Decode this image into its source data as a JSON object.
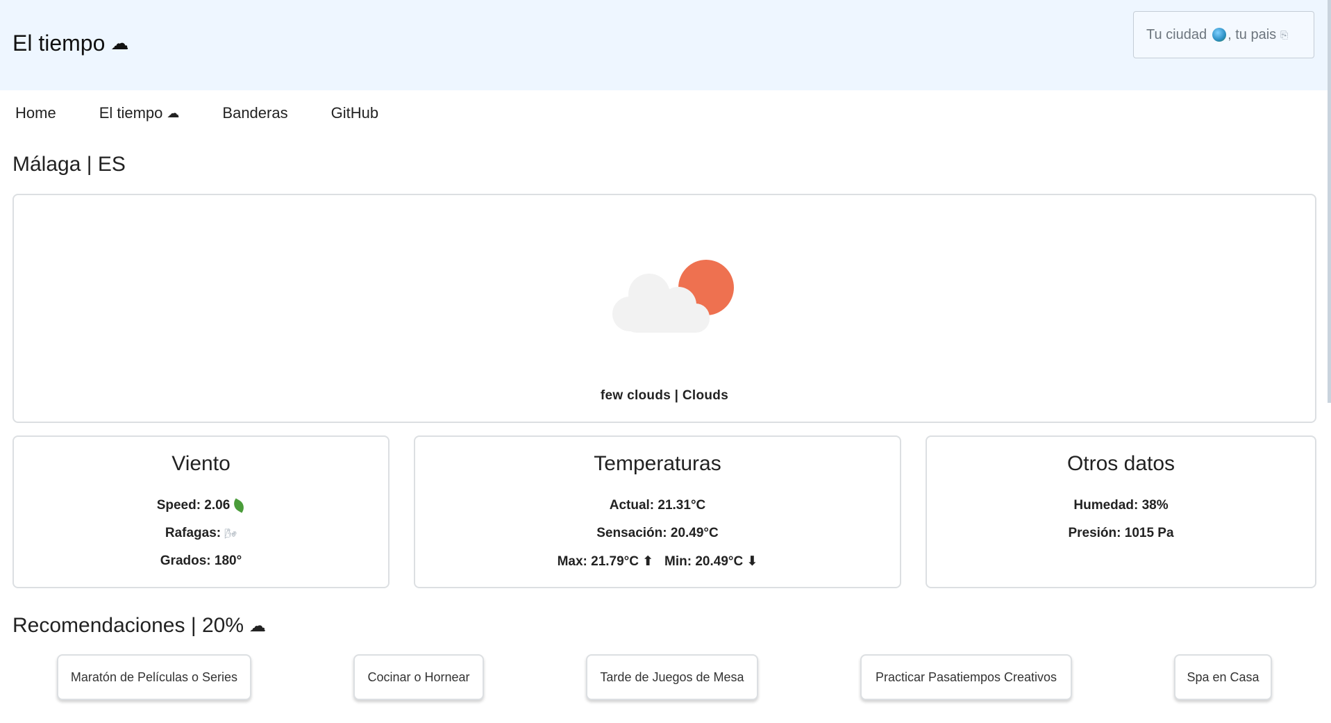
{
  "header": {
    "title": "El tiempo",
    "title_icon": "☁",
    "search_placeholder_prefix": "Tu ciudad",
    "search_placeholder_suffix": ", tu pais",
    "search_glyph": "⎘"
  },
  "nav": {
    "items": [
      {
        "label": "Home"
      },
      {
        "label": "El tiempo",
        "icon": "☁"
      },
      {
        "label": "Banderas"
      },
      {
        "label": "GitHub"
      }
    ]
  },
  "location": {
    "title": "Málaga | ES"
  },
  "weather": {
    "description": "few clouds | Clouds",
    "icon": "few-clouds-icon",
    "colors": {
      "sun": "#ee7150",
      "cloud": "#f2f2f2"
    }
  },
  "wind": {
    "title": "Viento",
    "speed": "Speed: 2.06",
    "gusts": "Rafagas:",
    "gusts_glyph": "🌬",
    "degrees": "Grados: 180°"
  },
  "temperatures": {
    "title": "Temperaturas",
    "current": "Actual: 21.31°C",
    "feels_like": "Sensación: 20.49°C",
    "max": "Max: 21.79°C ⬆",
    "min": "Min: 20.49°C ⬇"
  },
  "other": {
    "title": "Otros datos",
    "humidity": "Humedad: 38%",
    "pressure": "Presión: 1015 Pa"
  },
  "recommendations": {
    "title": "Recomendaciones | 20%",
    "icon": "☁",
    "items": [
      "Maratón de Películas o Series",
      "Cocinar o Hornear",
      "Tarde de Juegos de Mesa",
      "Practicar Pasatiempos Creativos",
      "Spa en Casa"
    ]
  }
}
